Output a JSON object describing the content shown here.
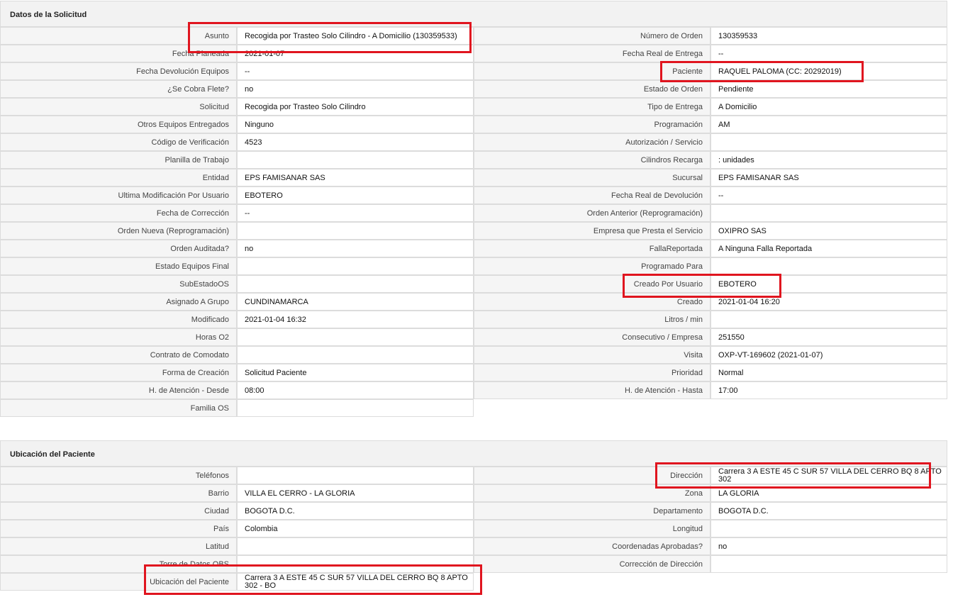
{
  "section1": {
    "title": "Datos de la Solicitud",
    "rows": [
      {
        "l_label": "Asunto",
        "l_value": "Recogida por Trasteo Solo Cilindro - A Domicilio (130359533)",
        "r_label": "Número de Orden",
        "r_value": "130359533"
      },
      {
        "l_label": "Fecha Planeada",
        "l_value": "2021-01-07",
        "r_label": "Fecha Real de Entrega",
        "r_value": "--"
      },
      {
        "l_label": "Fecha Devolución Equipos",
        "l_value": "--",
        "r_label": "Paciente",
        "r_value": "RAQUEL PALOMA (CC: 20292019)"
      },
      {
        "l_label": "¿Se Cobra Flete?",
        "l_value": "no",
        "r_label": "Estado de Orden",
        "r_value": "Pendiente"
      },
      {
        "l_label": "Solicitud",
        "l_value": "Recogida por Trasteo Solo Cilindro",
        "r_label": "Tipo de Entrega",
        "r_value": "A Domicilio"
      },
      {
        "l_label": "Otros Equipos Entregados",
        "l_value": "Ninguno",
        "r_label": "Programación",
        "r_value": "AM"
      },
      {
        "l_label": "Código de Verificación",
        "l_value": "4523",
        "r_label": "Autorización / Servicio",
        "r_value": ""
      },
      {
        "l_label": "Planilla de Trabajo",
        "l_value": "",
        "r_label": "Cilindros Recarga",
        "r_value": ": unidades"
      },
      {
        "l_label": "Entidad",
        "l_value": "EPS FAMISANAR SAS",
        "r_label": "Sucursal",
        "r_value": "EPS FAMISANAR SAS"
      },
      {
        "l_label": "Ultima Modificación Por Usuario",
        "l_value": "EBOTERO",
        "r_label": "Fecha Real de Devolución",
        "r_value": "--"
      },
      {
        "l_label": "Fecha de Corrección",
        "l_value": "--",
        "r_label": "Orden Anterior (Reprogramación)",
        "r_value": ""
      },
      {
        "l_label": "Orden Nueva (Reprogramación)",
        "l_value": "",
        "r_label": "Empresa que Presta el Servicio",
        "r_value": "OXIPRO SAS"
      },
      {
        "l_label": "Orden Auditada?",
        "l_value": "no",
        "r_label": "FallaReportada",
        "r_value": "A Ninguna Falla Reportada"
      },
      {
        "l_label": "Estado Equipos Final",
        "l_value": "",
        "r_label": "Programado Para",
        "r_value": ""
      },
      {
        "l_label": "SubEstadoOS",
        "l_value": "",
        "r_label": "Creado Por Usuario",
        "r_value": "EBOTERO"
      },
      {
        "l_label": "Asignado A Grupo",
        "l_value": "CUNDINAMARCA",
        "r_label": "Creado",
        "r_value": "2021-01-04 16:20"
      },
      {
        "l_label": "Modificado",
        "l_value": "2021-01-04 16:32",
        "r_label": "Litros / min",
        "r_value": ""
      },
      {
        "l_label": "Horas O2",
        "l_value": "",
        "r_label": "Consecutivo / Empresa",
        "r_value": "251550"
      },
      {
        "l_label": "Contrato de Comodato",
        "l_value": "",
        "r_label": "Visita",
        "r_value": "OXP-VT-169602 (2021-01-07)"
      },
      {
        "l_label": "Forma de Creación",
        "l_value": "Solicitud Paciente",
        "r_label": "Prioridad",
        "r_value": "Normal"
      },
      {
        "l_label": "H. de Atención - Desde",
        "l_value": "08:00",
        "r_label": "H. de Atención - Hasta",
        "r_value": "17:00"
      },
      {
        "l_label": "Familia OS",
        "l_value": ""
      }
    ]
  },
  "section2": {
    "title": "Ubicación del Paciente",
    "rows": [
      {
        "l_label": "Teléfonos",
        "l_value": "",
        "r_label": "Dirección",
        "r_value": "Carrera 3 A ESTE 45 C SUR 57 VILLA DEL CERRO BQ 8 APTO 302"
      },
      {
        "l_label": "Barrio",
        "l_value": "VILLA EL CERRO - LA GLORIA",
        "r_label": "Zona",
        "r_value": "LA GLORIA"
      },
      {
        "l_label": "Ciudad",
        "l_value": "BOGOTA D.C.",
        "r_label": "Departamento",
        "r_value": "BOGOTA D.C."
      },
      {
        "l_label": "País",
        "l_value": "Colombia",
        "r_label": "Longitud",
        "r_value": ""
      },
      {
        "l_label": "Latitud",
        "l_value": "",
        "r_label": "Coordenadas Aprobadas?",
        "r_value": "no"
      },
      {
        "l_label": "Torre de Datos OBS",
        "l_value": "",
        "r_label": "Corrección de Dirección",
        "r_value": ""
      },
      {
        "l_label": "Ubicación del Paciente",
        "l_value": "Carrera 3 A ESTE 45 C SUR 57 VILLA DEL CERRO BQ 8 APTO 302 - BO"
      }
    ]
  },
  "highlight_color": "#e0151f"
}
